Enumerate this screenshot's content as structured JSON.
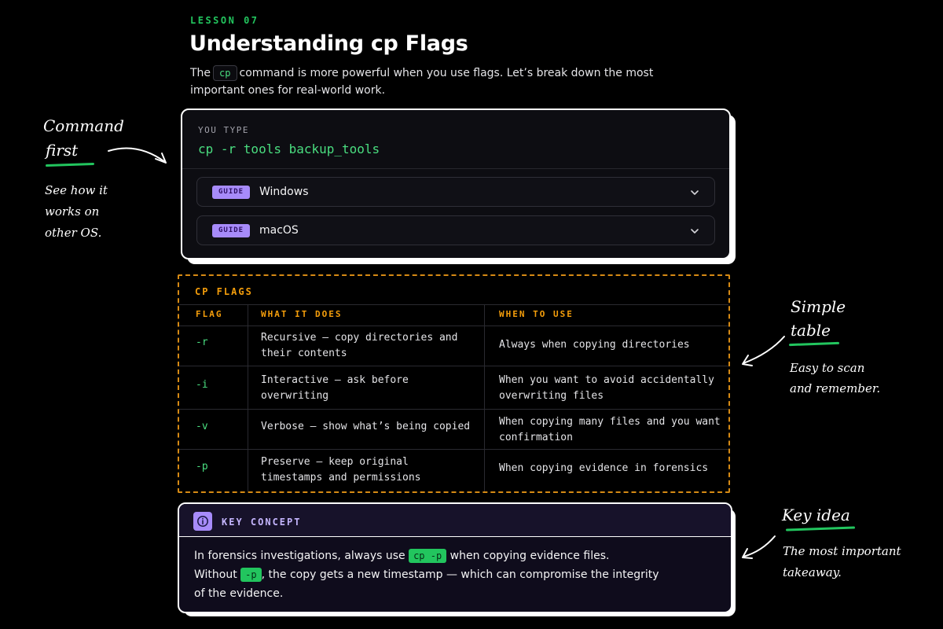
{
  "header": {
    "lesson_tag": "LESSON 07",
    "title": "Understanding cp Flags",
    "intro_before": "The",
    "intro_chip": "cp",
    "intro_after": "command is more powerful when you use flags. Let’s break down the most important ones for real-world work."
  },
  "terminal": {
    "label": "YOU TYPE",
    "command": "cp -r tools backup_tools",
    "guides": [
      {
        "badge": "GUIDE",
        "label": "Windows"
      },
      {
        "badge": "GUIDE",
        "label": "macOS"
      }
    ]
  },
  "flags_table": {
    "title": "CP FLAGS",
    "headers": [
      "FLAG",
      "WHAT IT DOES",
      "WHEN TO USE"
    ],
    "rows": [
      {
        "flag": "-r",
        "what": "Recursive — copy directories and their contents",
        "when": "Always when copying directories"
      },
      {
        "flag": "-i",
        "what": "Interactive — ask before overwriting",
        "when": "When you want to avoid accidentally overwriting files"
      },
      {
        "flag": "-v",
        "what": "Verbose — show what’s being copied",
        "when": "When copying many files and you want confirmation"
      },
      {
        "flag": "-p",
        "what": "Preserve — keep original timestamps and permissions",
        "when": "When copying evidence in forensics"
      }
    ]
  },
  "key_concept": {
    "title": "KEY CONCEPT",
    "icon": "info-icon",
    "text_1": "In forensics investigations, always use",
    "chip_1": "cp -p",
    "text_2": "when copying evidence files.",
    "text_3": "Without",
    "chip_2": "-p",
    "text_4": ", the copy gets a new timestamp — which can compromise the integrity of the evidence."
  },
  "annotations": {
    "command_first_1": "Command",
    "command_first_2": "first",
    "see_how_1": "See how it",
    "see_how_2": "works on",
    "see_how_3": "other OS.",
    "simple_table_1": "Simple",
    "simple_table_2": "table",
    "easy_scan_1": "Easy to scan",
    "easy_scan_2": "and remember.",
    "key_idea": "Key idea",
    "most_important_1": "The most important",
    "most_important_2": "takeaway."
  },
  "colors": {
    "accent_green": "#22c55e",
    "accent_orange": "#f59e0b",
    "accent_purple": "#a78bfa",
    "background": "#000000"
  }
}
